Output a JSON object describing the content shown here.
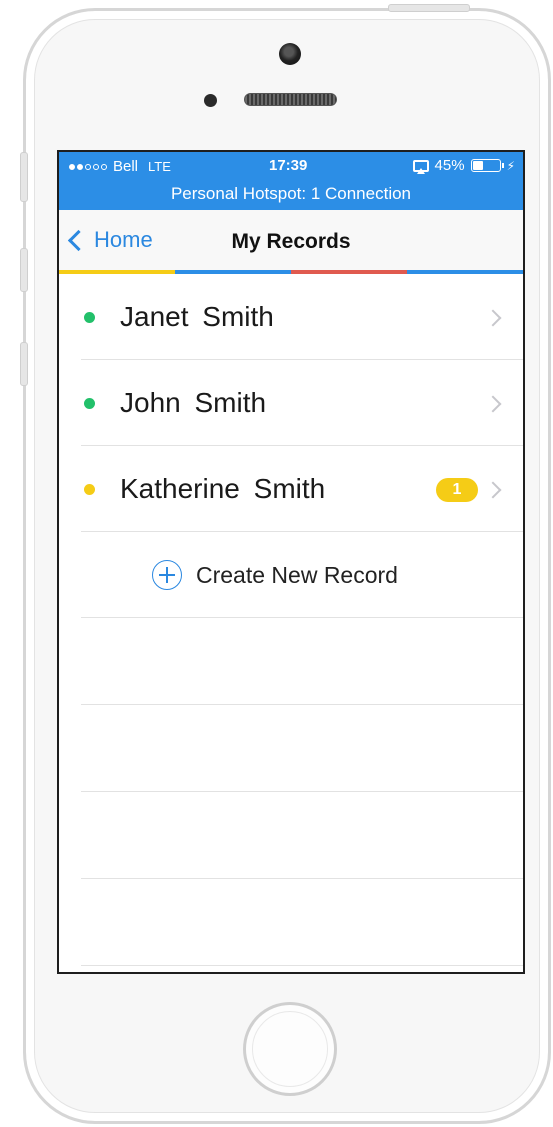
{
  "status_bar": {
    "carrier": "Bell",
    "network": "LTE",
    "time": "17:39",
    "battery_percent": "45%",
    "battery_level": 0.45,
    "hotspot": "Personal Hotspot: 1 Connection",
    "signal_bars": [
      1,
      1,
      0,
      0,
      0
    ]
  },
  "nav": {
    "back_label": "Home",
    "title": "My Records",
    "accent_colors": [
      "#f5cc16",
      "#2c8ee6",
      "#e05a4f",
      "#2c8ee6"
    ]
  },
  "records": [
    {
      "name": "Janet Smith",
      "status_color": "#22c06a",
      "badge": ""
    },
    {
      "name": "John Smith",
      "status_color": "#22c06a",
      "badge": ""
    },
    {
      "name": "Katherine Smith",
      "status_color": "#f5cc16",
      "badge": "1"
    }
  ],
  "create_label": "Create New Record",
  "colors": {
    "accent": "#2c8ee6",
    "link": "#2b88e0"
  }
}
